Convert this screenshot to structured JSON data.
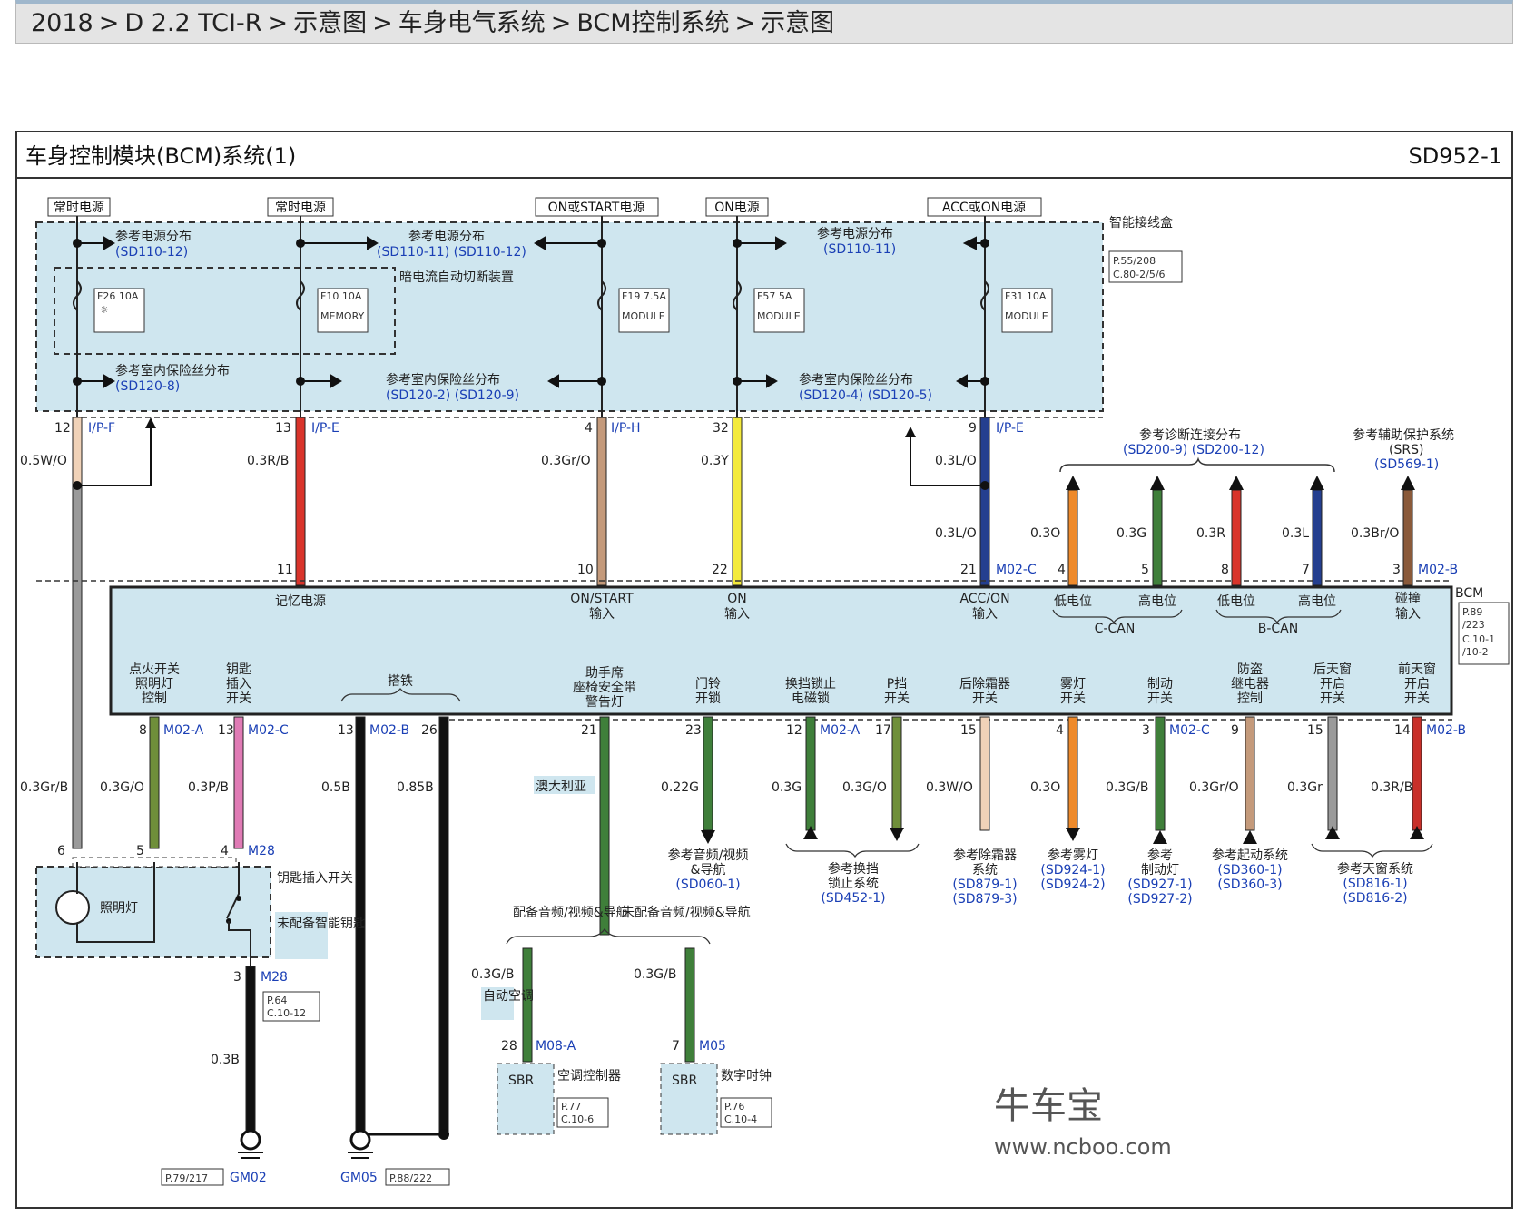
{
  "breadcrumb": [
    "2018",
    "D 2.2 TCI-R",
    "示意图",
    "车身电气系统",
    "BCM控制系统",
    "示意图"
  ],
  "diagram": {
    "title": "车身控制模块(BCM)系统(1)",
    "code": "SD952-1",
    "top_sources": [
      "常时电源",
      "常时电源",
      "ON或START电源",
      "ON电源",
      "ACC或ON电源"
    ],
    "junction_box": {
      "label": "智能接线盒",
      "page": "P.55/208",
      "connector": "C.80-2/5/6"
    },
    "refs_top": {
      "power1": "参考电源分布",
      "power1_code": "(SD110-12)",
      "power2": "参考电源分布",
      "power2_code": "(SD110-11) (SD110-12)",
      "power3": "参考电源分布",
      "power3_code": "(SD110-11)",
      "fuse1": "参考室内保险丝分布",
      "fuse1_code": "(SD120-8)",
      "fuse2": "参考室内保险丝分布",
      "fuse2_code": "(SD120-2) (SD120-9)",
      "fuse3": "参考室内保险丝分布",
      "fuse3_code": "(SD120-4) (SD120-5)",
      "cutoff": "暗电流自动切断装置"
    },
    "fuses": [
      {
        "name": "F26 10A",
        "sub": ""
      },
      {
        "name": "F10 10A",
        "sub": "MEMORY"
      },
      {
        "name": "F19 7.5A",
        "sub": "MODULE"
      },
      {
        "name": "F57 5A",
        "sub": "MODULE"
      },
      {
        "name": "F31 10A",
        "sub": "MODULE"
      }
    ],
    "top_wires": [
      {
        "pin": "12",
        "conn": "I/P-F",
        "spec": "0.5W/O"
      },
      {
        "pin": "13",
        "conn": "I/P-E",
        "spec": "0.3R/B",
        "bcm_pin": "11"
      },
      {
        "pin": "4",
        "conn": "I/P-H",
        "spec": "0.3Gr/O",
        "bcm_pin": "10"
      },
      {
        "pin": "32",
        "conn": "",
        "spec": "0.3Y",
        "bcm_pin": "22"
      },
      {
        "pin": "9",
        "conn": "I/P-E",
        "spec": "0.3L/O",
        "spec2": "0.3L/O",
        "bcm_pin": "21",
        "bcm_conn": "M02-C"
      }
    ],
    "can": {
      "ref": "参考诊断连接分布",
      "ref_code": "(SD200-9) (SD200-12)",
      "wires": [
        {
          "spec": "0.3O",
          "pin": "4"
        },
        {
          "spec": "0.3G",
          "pin": "5"
        },
        {
          "spec": "0.3R",
          "pin": "8"
        },
        {
          "spec": "0.3L",
          "pin": "7"
        }
      ],
      "srs_ref": "参考辅助保护系统",
      "srs_ref2": "(SRS)",
      "srs_code": "(SD569-1)",
      "srs_spec": "0.3Br/O",
      "srs_pin": "3",
      "srs_conn": "M02-B"
    },
    "bcm": {
      "label": "BCM",
      "page": "P.89",
      "page2": "/223",
      "conn": "C.10-1",
      "conn2": "/10-2",
      "top_labels": [
        [
          "记忆电源"
        ],
        [
          "ON/START",
          "输入"
        ],
        [
          "ON",
          "输入"
        ],
        [
          "ACC/ON",
          "输入"
        ],
        [
          "低电位"
        ],
        [
          "高电位"
        ],
        [
          "低电位"
        ],
        [
          "高电位"
        ],
        [
          "碰撞",
          "输入"
        ]
      ],
      "can_c": "C-CAN",
      "can_b": "B-CAN",
      "bottom_labels": [
        [
          "点火开关",
          "照明灯",
          "控制"
        ],
        [
          "钥匙",
          "插入",
          "开关"
        ],
        [
          "搭铁"
        ],
        [
          "助手席",
          "座椅安全带",
          "警告灯"
        ],
        [
          "门铃",
          "开锁"
        ],
        [
          "换挡锁止",
          "电磁锁"
        ],
        [
          "P挡",
          "开关"
        ],
        [
          "后除霜器",
          "开关"
        ],
        [
          "雾灯",
          "开关"
        ],
        [
          "制动",
          "开关"
        ],
        [
          "防盗",
          "继电器",
          "控制"
        ],
        [
          "后天窗",
          "开启",
          "开关"
        ],
        [
          "前天窗",
          "开启",
          "开关"
        ]
      ]
    },
    "bottom_wires": [
      {
        "pin": "8",
        "conn": "M02-A",
        "spec": "0.3G/O"
      },
      {
        "pin": "13",
        "conn": "M02-C",
        "spec": "0.3P/B"
      },
      {
        "pin": "13",
        "conn": "M02-B",
        "spec": "0.5B"
      },
      {
        "pin": "26",
        "conn": "",
        "spec": "0.85B"
      },
      {
        "pin": "21",
        "conn": "",
        "spec": ""
      },
      {
        "pin": "23",
        "conn": "",
        "spec": "0.22G"
      },
      {
        "pin": "12",
        "conn": "M02-A",
        "spec": "0.3G"
      },
      {
        "pin": "17",
        "conn": "",
        "spec": "0.3G/O"
      },
      {
        "pin": "15",
        "conn": "",
        "spec": "0.3W/O"
      },
      {
        "pin": "4",
        "conn": "",
        "spec": "0.3O"
      },
      {
        "pin": "3",
        "conn": "M02-C",
        "spec": "0.3G/B"
      },
      {
        "pin": "9",
        "conn": "",
        "spec": "0.3Gr/O"
      },
      {
        "pin": "15",
        "conn": "",
        "spec": "0.3Gr"
      },
      {
        "pin": "14",
        "conn": "M02-B",
        "spec": "0.3R/B"
      }
    ],
    "left": {
      "spec_gr": "0.3Gr/B",
      "switch_pin6": "6",
      "switch_pin5": "5",
      "switch_pin4": "4",
      "switch_conn": "M28",
      "lamp": "照明灯",
      "switch_label": "钥匙插入开关",
      "not_equipped": "未配备智能钥匙",
      "pin3": "3",
      "conn3": "M28",
      "page": "P.64",
      "connector": "C.10-12",
      "ground_spec": "0.3B",
      "gm02_page": "P.79/217",
      "gm02": "GM02",
      "gm05": "GM05",
      "gm05_page": "P.88/222"
    },
    "middle": {
      "australia": "澳大利亚",
      "equipped": "配备音频/视频&导航",
      "not_equipped": "未配备音频/视频&导航",
      "spec_a": "0.3G/B",
      "spec_b": "0.3G/B",
      "auto_ac": "自动空调",
      "ac_pin": "28",
      "ac_conn": "M08-A",
      "ac_sbr": "SBR",
      "ac_name": "空调控制器",
      "ac_page": "P.77",
      "ac_connector": "C.10-6",
      "clock_pin": "7",
      "clock_conn": "M05",
      "clock_sbr": "SBR",
      "clock_name": "数字时钟",
      "clock_page": "P.76",
      "clock_connector": "C.10-4"
    },
    "bottom_refs": [
      {
        "line1": "参考音频/视频",
        "line2": "&导航",
        "code1": "(SD060-1)",
        "code2": ""
      },
      {
        "line1": "参考换挡",
        "line2": "锁止系统",
        "code1": "(SD452-1)",
        "code2": ""
      },
      {
        "line1": "参考除霜器",
        "line2": "系统",
        "code1": "(SD879-1)",
        "code2": "(SD879-3)"
      },
      {
        "line1": "参考雾灯",
        "line2": "",
        "code1": "(SD924-1)",
        "code2": "(SD924-2)"
      },
      {
        "line1": "参考",
        "line2": "制动灯",
        "code1": "(SD927-1)",
        "code2": "(SD927-2)"
      },
      {
        "line1": "参考起动系统",
        "line2": "",
        "code1": "(SD360-1)",
        "code2": "(SD360-3)"
      },
      {
        "line1": "参考天窗系统",
        "line2": "",
        "code1": "(SD816-1)",
        "code2": "(SD816-2)"
      }
    ],
    "watermark_cn": "牛车宝",
    "watermark_url": "www.ncboo.com",
    "colors": {
      "fill_box": "#cfe6ef",
      "red": "#d9342b",
      "yellow": "#f4ea3c",
      "navy": "#243f8f",
      "green": "#3f7f3a",
      "orange": "#ee8a2b",
      "brown": "#8a5a3a",
      "gray": "#8f8f8f",
      "pink": "#e07bb5",
      "blue": "#1a3fb5"
    }
  }
}
